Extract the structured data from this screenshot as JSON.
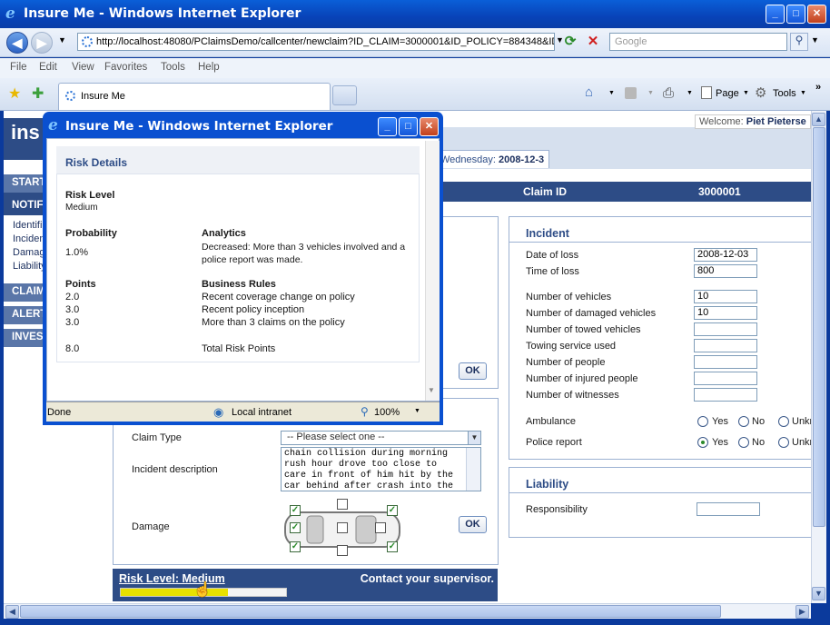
{
  "main_window": {
    "title": "Insure Me - Windows Internet Explorer"
  },
  "address": {
    "url": "http://localhost:48080/PClaimsDemo/callcenter/newclaim?ID_CLAIM=3000001&ID_POLICY=884348&ID_CUSTOMER",
    "search_placeholder": "Google"
  },
  "menu": {
    "file": "File",
    "edit": "Edit",
    "view": "View",
    "favorites": "Favorites",
    "tools": "Tools",
    "help": "Help"
  },
  "tabs": {
    "active": "Insure Me"
  },
  "toolbar": {
    "page": "Page",
    "tools": "Tools"
  },
  "app": {
    "logo": "ins",
    "welcome_prefix": "Welcome:",
    "welcome_user": "Piet Pieterse",
    "date_prefix": "Wednesday:",
    "date": "2008-12-3",
    "claim_id_label": "Claim ID",
    "claim_id": "3000001",
    "nav": {
      "start": "START",
      "notify": "NOTIF",
      "claim": "CLAIM",
      "alert": "ALERT",
      "invest": "INVES",
      "subs": [
        "Identifi",
        "Inciden",
        "Damag",
        "Liability"
      ]
    },
    "incident": {
      "title": "Incident",
      "date_of_loss_label": "Date of loss",
      "date_of_loss": "2008-12-03",
      "time_of_loss_label": "Time of loss",
      "time_of_loss": "800",
      "num_vehicles_label": "Number of vehicles",
      "num_vehicles": "10",
      "num_damaged_label": "Number of damaged vehicles",
      "num_damaged": "10",
      "num_towed_label": "Number of towed vehicles",
      "towing_label": "Towing service used",
      "people_label": "Number of people",
      "injured_label": "Number of injured people",
      "witnesses_label": "Number of witnesses",
      "ambulance_label": "Ambulance",
      "police_label": "Police report",
      "yes": "Yes",
      "no": "No",
      "unknown": "Unkn"
    },
    "liability": {
      "title": "Liability",
      "responsibility_label": "Responsibility"
    },
    "claim_form": {
      "claim_type_label": "Claim Type",
      "claim_type_value": "-- Please select one --",
      "incident_desc_label": "Incident description",
      "incident_desc": "chain collision during morning rush hour drove too close to care in front of him hit by the car behind after crash into the",
      "damage_label": "Damage",
      "ok": "OK"
    },
    "risk_bar": {
      "label": "Risk Level: Medium",
      "message": "Contact your supervisor.",
      "level_fraction": 0.65
    }
  },
  "popup": {
    "title": "Insure Me - Windows Internet Explorer",
    "heading": "Risk Details",
    "risk_level_label": "Risk Level",
    "risk_level": "Medium",
    "probability_label": "Probability",
    "probability": "1.0%",
    "analytics_label": "Analytics",
    "analytics": "Decreased: More than 3 vehicles involved and a police report was made.",
    "points_label": "Points",
    "rules_label": "Business Rules",
    "rules": [
      {
        "points": "2.0",
        "rule": "Recent coverage change on policy"
      },
      {
        "points": "3.0",
        "rule": "Recent policy inception"
      },
      {
        "points": "3.0",
        "rule": "More than 3 claims on the policy"
      }
    ],
    "total_points": "8.0",
    "total_label": "Total Risk Points",
    "status_done": "Done",
    "status_zone": "Local intranet",
    "status_zoom": "100%"
  },
  "colors": {
    "accent": "#2d4c86",
    "titlebar": "#0843b8",
    "risk_fill": "#e8e000"
  }
}
